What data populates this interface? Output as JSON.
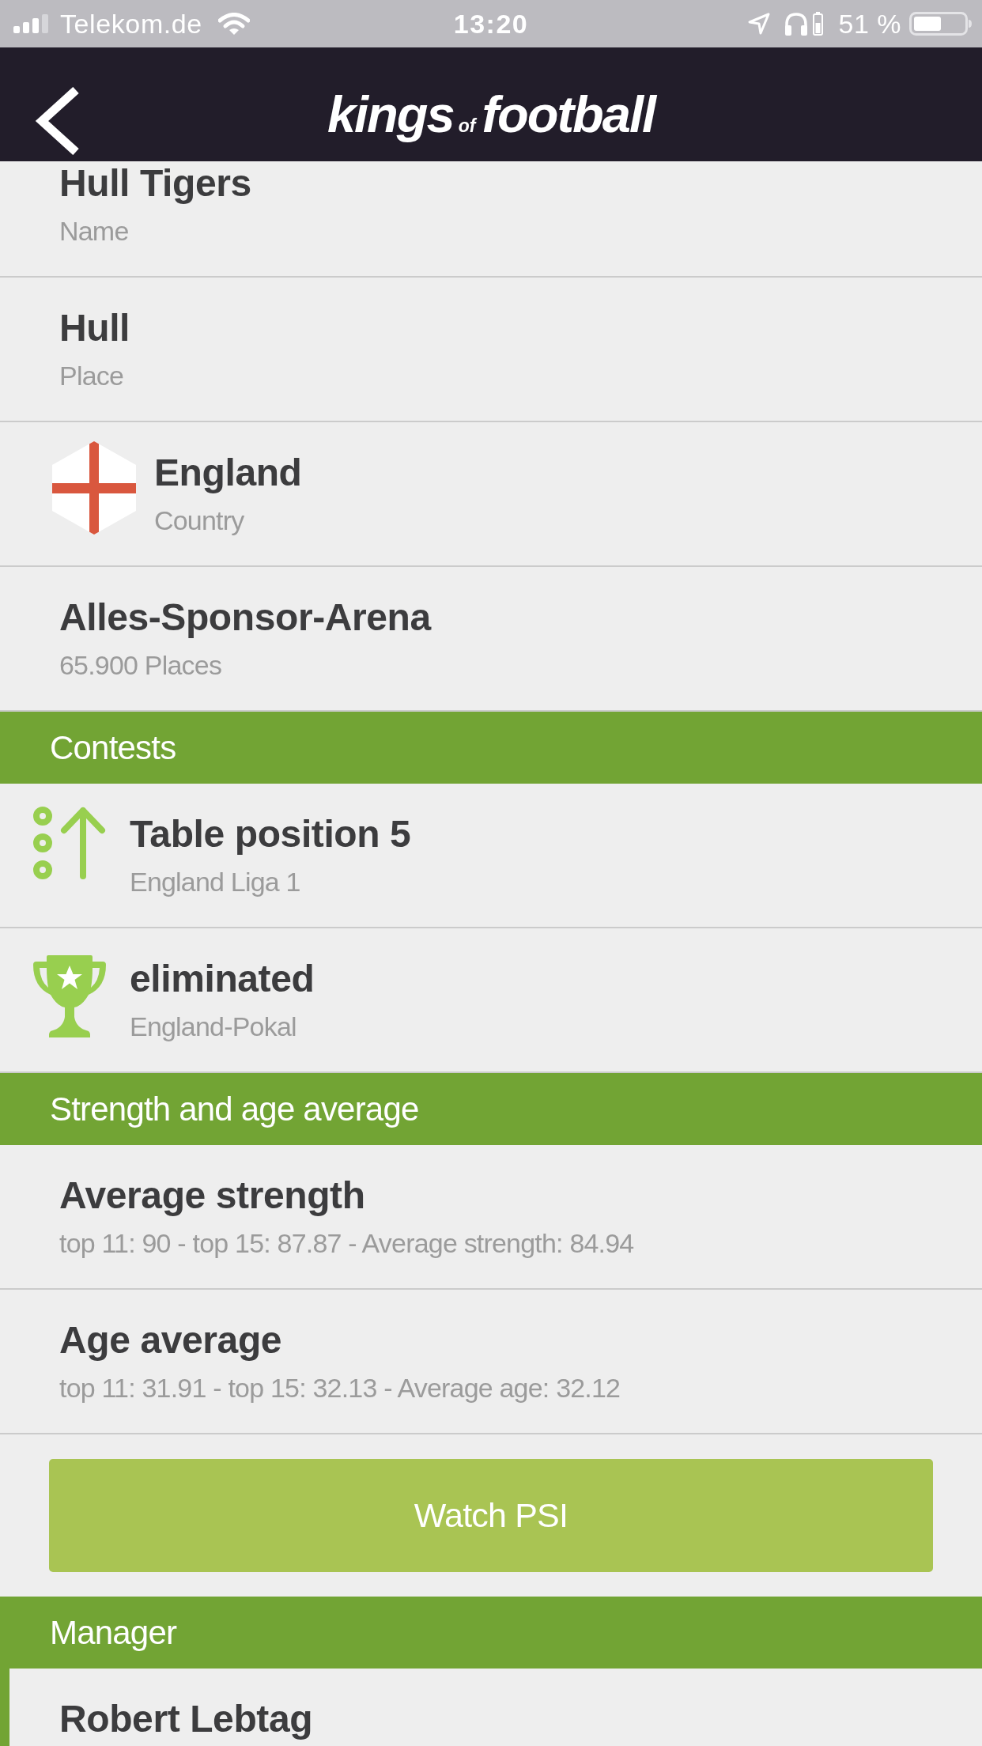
{
  "status_bar": {
    "carrier": "Telekom.de",
    "time": "13:20",
    "battery": "51 %"
  },
  "header": {
    "logo": {
      "before": "kings",
      "middle": "of",
      "after": "football"
    }
  },
  "details": [
    {
      "kind": "plain",
      "title": "Hull Tigers",
      "subtitle": "Name",
      "highlighted": false
    },
    {
      "kind": "plain",
      "title": "Hull",
      "subtitle": "Place",
      "highlighted": false
    },
    {
      "kind": "flag",
      "title": "England",
      "subtitle": "Country",
      "highlighted": false
    },
    {
      "kind": "plain",
      "title": "Alles-Sponsor-Arena",
      "subtitle": "65.900 Places",
      "highlighted": false
    }
  ],
  "sections": [
    {
      "heading": "Contests",
      "rows": [
        {
          "kind": "table",
          "title": "Table position 5",
          "subtitle": "England Liga 1",
          "highlighted": false
        },
        {
          "kind": "cup",
          "title": "eliminated",
          "subtitle": "England-Pokal",
          "highlighted": false
        }
      ]
    },
    {
      "heading": "Strength and age average",
      "rows": [
        {
          "kind": "plain",
          "title": "Average strength",
          "subtitle": "top 11: 90 - top 15: 87.87 - Average strength: 84.94",
          "highlighted": false
        },
        {
          "kind": "plain",
          "title": "Age average",
          "subtitle": "top 11: 31.91 - top 15: 32.13 - Average age: 32.12",
          "highlighted": false
        }
      ],
      "button": "Watch PSI"
    },
    {
      "heading": "Manager",
      "rows": [
        {
          "kind": "plain",
          "title": "Robert Lebtag",
          "highlighted": true
        }
      ]
    }
  ]
}
